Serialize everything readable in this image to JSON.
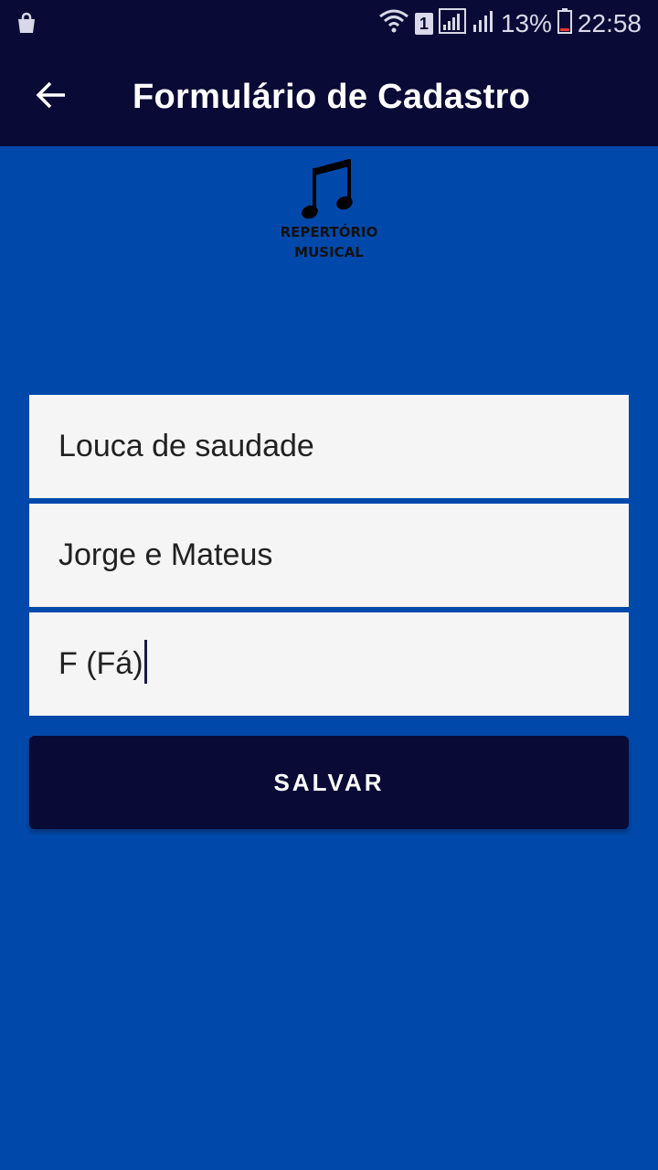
{
  "status_bar": {
    "sim_badge": "1",
    "battery": "13%",
    "time": "22:58",
    "icons": [
      "shopping-bag-icon",
      "wifi-icon",
      "sim-icon",
      "signal-icon",
      "signal-icon",
      "battery-icon"
    ]
  },
  "app_bar": {
    "title": "Formulário de Cadastro",
    "back_icon": "arrow-left-icon"
  },
  "logo": {
    "line1": "REPERTÓRIO",
    "line2": "MUSICAL",
    "icon": "music-note-icon"
  },
  "form": {
    "song": "Louca de saudade",
    "artist": "Jorge e Mateus",
    "key": "F (Fá)"
  },
  "save_button": {
    "label": "SALVAR"
  },
  "colors": {
    "background": "#0049AB",
    "bar": "#0A0A36",
    "field": "#F5F5F5",
    "text": "#212121"
  }
}
